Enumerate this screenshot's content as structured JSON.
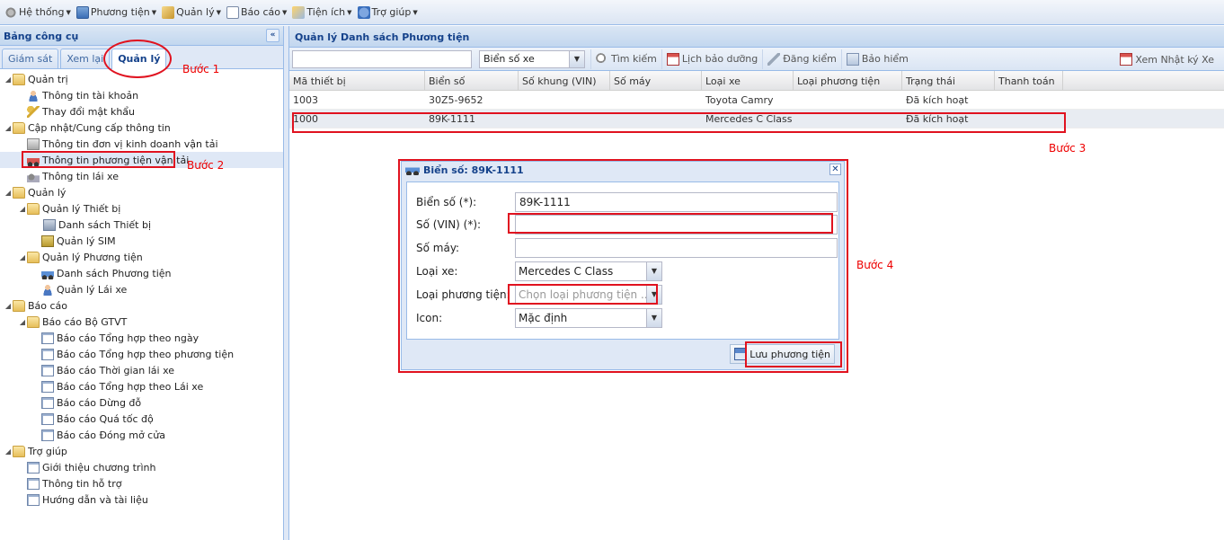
{
  "menubar": {
    "items": [
      {
        "label": "Hệ thống",
        "icon": "gear-icon"
      },
      {
        "label": "Phương tiện",
        "icon": "tv-icon"
      },
      {
        "label": "Quản lý",
        "icon": "box-icon"
      },
      {
        "label": "Báo cáo",
        "icon": "doc-icon"
      },
      {
        "label": "Tiện ích",
        "icon": "tools-icon"
      },
      {
        "label": "Trợ giúp",
        "icon": "help-icon"
      }
    ]
  },
  "left_panel": {
    "title": "Bảng công cụ",
    "collapse": "«",
    "tabs": [
      "Giám sát",
      "Xem lại",
      "Quản lý"
    ],
    "active_tab": "Quản lý"
  },
  "tree": {
    "n0": "Quản trị",
    "n1": "Thông tin tài khoản",
    "n2": "Thay đổi mật khẩu",
    "n3": "Cập nhật/Cung cấp thông tin",
    "n4": "Thông tin đơn vị kinh doanh vận tải",
    "n5": "Thông tin phương tiện vận tải",
    "n6": "Thông tin lái xe",
    "n7": "Quản lý",
    "n8": "Quản lý Thiết bị",
    "n9": "Danh sách Thiết bị",
    "n10": "Quản lý SIM",
    "n11": "Quản lý Phương tiện",
    "n12": "Danh sách Phương tiện",
    "n13": "Quản lý Lái xe",
    "n14": "Báo cáo",
    "n15": "Báo cáo Bộ GTVT",
    "n16": "Báo cáo Tổng hợp theo ngày",
    "n17": "Báo cáo Tổng hợp theo phương tiện",
    "n18": "Báo cáo Thời gian lái xe",
    "n19": "Báo cáo Tổng hợp theo Lái xe",
    "n20": "Báo cáo Dừng đỗ",
    "n21": "Báo cáo Quá tốc độ",
    "n22": "Báo cáo Đóng mở cửa",
    "n23": "Trợ giúp",
    "n24": "Giới thiệu chương trình",
    "n25": "Thông tin hỗ trợ",
    "n26": "Hướng dẫn và tài liệu"
  },
  "steps": {
    "s1": "Bước 1",
    "s2": "Bước 2",
    "s3": "Bước 3",
    "s4": "Bước 4"
  },
  "main": {
    "title": "Quản lý Danh sách Phương tiện",
    "search_value": "",
    "filter_combo": "Biển số xe",
    "btn_search": "Tìm kiếm",
    "btn_maintenance": "Lịch bảo dưỡng",
    "btn_register": "Đăng kiểm",
    "btn_insurance": "Bảo hiểm",
    "btn_log": "Xem Nhật ký Xe",
    "columns": [
      "Mã thiết bị",
      "Biển số",
      "Số khung (VIN)",
      "Số máy",
      "Loại xe",
      "Loại phương tiện",
      "Trạng thái",
      "Thanh toán"
    ],
    "rows": [
      [
        "1003",
        "30Z5-9652",
        "",
        "",
        "Toyota Camry",
        "",
        "Đã kích hoạt",
        ""
      ],
      [
        "1000",
        "89K-1111",
        "",
        "",
        "Mercedes C Class",
        "",
        "Đã kích hoạt",
        ""
      ]
    ]
  },
  "dialog": {
    "title": "Biển số: 89K-1111",
    "close": "✕",
    "plate_label": "Biển số (*):",
    "plate_value": "89K-1111",
    "vin_label": "Số (VIN) (*):",
    "vin_value": "",
    "engine_label": "Số máy:",
    "engine_value": "",
    "cartype_label": "Loại xe:",
    "cartype_value": "Mercedes C Class",
    "vehicletype_label": "Loại phương tiện:",
    "vehicletype_placeholder": "Chọn loại phương tiện ...",
    "icon_label": "Icon:",
    "icon_value": "Mặc định",
    "save_label": "Lưu phương tiện"
  }
}
